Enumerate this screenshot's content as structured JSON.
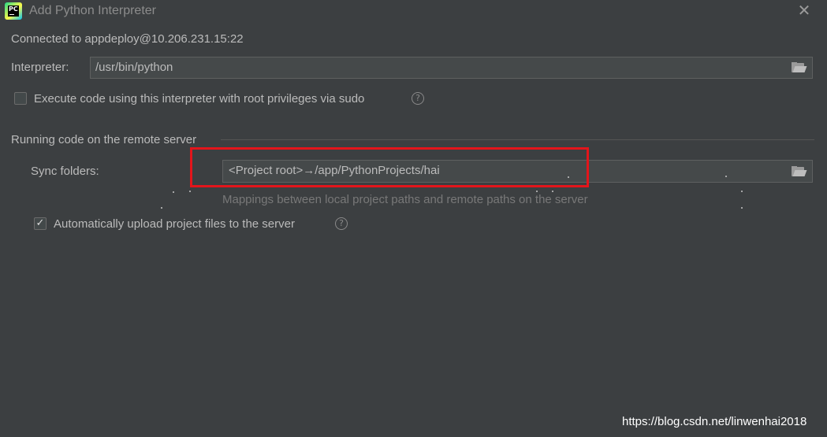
{
  "window": {
    "title": "Add Python Interpreter",
    "app_icon_text": "PC",
    "close_glyph": "✕"
  },
  "connection": {
    "text": "Connected to appdeploy@10.206.231.15:22"
  },
  "interpreter": {
    "label": "Interpreter:",
    "value": "/usr/bin/python"
  },
  "sudo": {
    "label": "Execute code using this interpreter with root privileges via sudo",
    "checked": false
  },
  "remote_section": {
    "title": "Running code on the remote server",
    "sync_label": "Sync folders:",
    "sync_value": "<Project root>→/app/PythonProjects/hai",
    "hint": "Mappings between local project paths and remote paths on the server"
  },
  "auto_upload": {
    "label": "Automatically upload project files to the server",
    "checked": true,
    "check_glyph": "✓"
  },
  "help_glyph": "?",
  "watermark": "https://blog.csdn.net/linwenhai2018",
  "colors": {
    "background": "#3c3f41",
    "text": "#bbbbbb",
    "field": "#45494a",
    "highlight_box": "#e3151b"
  },
  "icons": {
    "browse": "folder-open-icon",
    "help": "question-circle-icon",
    "close": "close-icon",
    "app": "pycharm-icon"
  }
}
